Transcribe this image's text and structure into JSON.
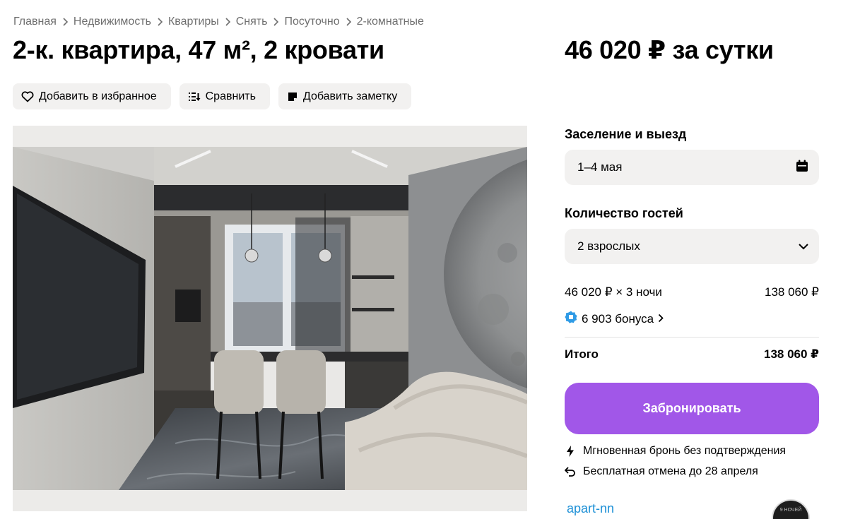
{
  "breadcrumbs": [
    "Главная",
    "Недвижимость",
    "Квартиры",
    "Снять",
    "Посуточно",
    "2-комнатные"
  ],
  "title": "2-к. квартира, 47 м², 2 кровати",
  "price_title": "46 020 ₽ за сутки",
  "actions": {
    "favorite": "Добавить в избранное",
    "compare": "Сравнить",
    "note": "Добавить заметку"
  },
  "booking": {
    "dates_label": "Заселение и выезд",
    "dates_value": "1–4 мая",
    "guests_label": "Количество гостей",
    "guests_value": "2 взрослых",
    "calc_label": "46 020 ₽ × 3 ночи",
    "calc_value": "138 060 ₽",
    "bonus": "6 903 бонуса",
    "total_label": "Итого",
    "total_value": "138 060 ₽",
    "book_button": "Забронировать",
    "instant": "Мгновенная бронь без подтверждения",
    "cancel": "Бесплатная отмена до 28 апреля"
  },
  "seller": {
    "name": "apart-nn",
    "avatar_text": "9 НОЧЕЙ"
  },
  "colors": {
    "accent": "#a157e8",
    "link": "#1b8fd6",
    "chip_bg": "#f2f1f0",
    "bonus_icon": "#2f9be6"
  },
  "icons": {
    "favorite": "heart-icon",
    "compare": "compare-icon",
    "note": "note-icon",
    "calendar": "calendar-icon",
    "chevron": "chevron-down-icon",
    "bonus": "bonus-badge-icon",
    "instant": "lightning-icon",
    "cancel": "return-arrow-icon"
  }
}
